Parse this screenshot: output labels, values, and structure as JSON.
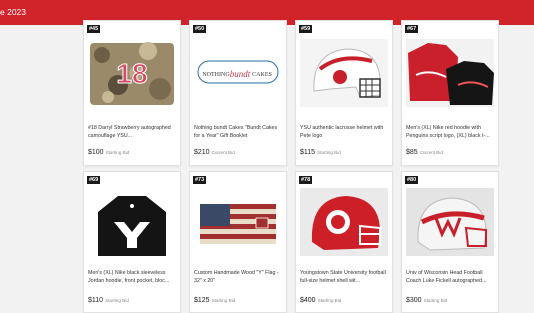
{
  "header": {
    "title": "e 2023"
  },
  "items": [
    {
      "lot": "#45",
      "title": "#18 Darryl Strawberry autographed camouflage YSU...",
      "price": "$100",
      "price_label": "Starting Bid"
    },
    {
      "lot": "#50",
      "title": "Nothing bundt Cakes \"Bundt Cakes for a Year\" Gift Booklet",
      "price": "$210",
      "price_label": "Current Bid",
      "logo_text_1": "NOTHING",
      "logo_text_2": "bundt",
      "logo_text_3": "CAKES"
    },
    {
      "lot": "#59",
      "title": "YSU authentic lacrosse helmet with Pete logo",
      "price": "$115",
      "price_label": "Starting Bid"
    },
    {
      "lot": "#67",
      "title": "Men's (XL) Nike red hoodie with Penguins script logo, (XL) black t-...",
      "price": "$85",
      "price_label": "Current Bid"
    },
    {
      "lot": "#69",
      "title": "Men's (XL) Nike black sleeveless Jordan hoodie, front pocket, bloc...",
      "price": "$110",
      "price_label": "Starting Bid"
    },
    {
      "lot": "#73",
      "title": "Custom Handmade Wood \"Y\" Flag - 32\" x 20\"",
      "price": "$125",
      "price_label": "Starting Bid"
    },
    {
      "lot": "#78",
      "title": "Youngstown State University football full-size helmet shell wit...",
      "price": "$400",
      "price_label": "Starting Bid"
    },
    {
      "lot": "#80",
      "title": "Univ of Wisconsin Head Football Coach Luke Fickell autographed...",
      "price": "$300",
      "price_label": "Starting Bid"
    }
  ]
}
